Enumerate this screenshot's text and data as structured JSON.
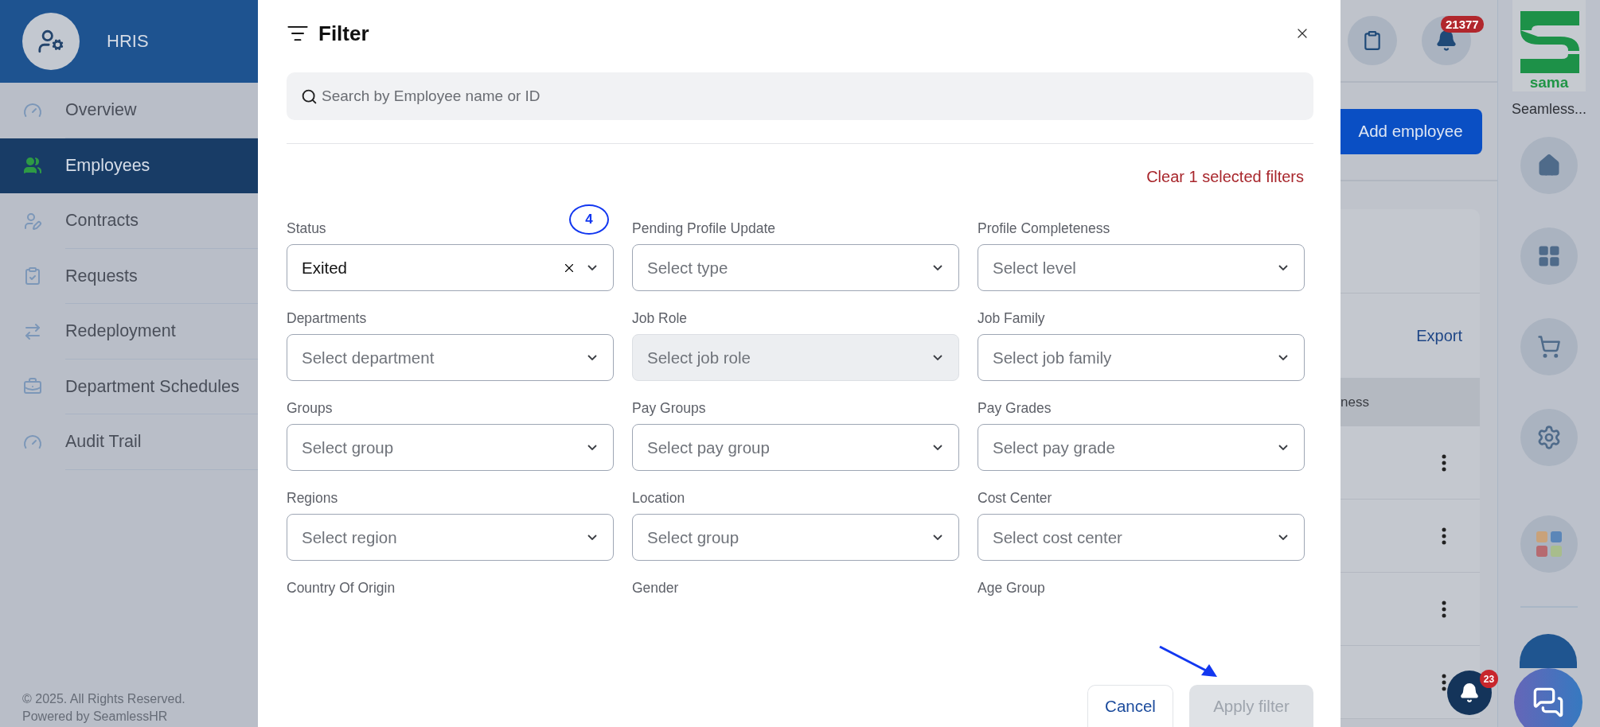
{
  "sidebar": {
    "title": "HRIS",
    "items": [
      {
        "label": "Overview",
        "selected": false
      },
      {
        "label": "Employees",
        "selected": true
      },
      {
        "label": "Contracts",
        "selected": false
      },
      {
        "label": "Requests",
        "selected": false
      },
      {
        "label": "Redeployment",
        "selected": false
      },
      {
        "label": "Department Schedules",
        "selected": false
      },
      {
        "label": "Audit Trail",
        "selected": false
      }
    ],
    "footer": [
      "© 2025. All Rights Reserved.",
      "Powered by SeamlessHR"
    ]
  },
  "filter_dialog": {
    "title": "Filter",
    "search": {
      "placeholder": "Search by Employee name or ID"
    },
    "clear_link": "Clear 1 selected filters",
    "fields": [
      {
        "kind": "select",
        "label": "Status",
        "value": "Exited",
        "disabled": false
      },
      {
        "kind": "select",
        "label": "Pending Profile Update",
        "placeholder": "Select type",
        "disabled": false
      },
      {
        "kind": "select",
        "label": "Profile Completeness",
        "placeholder": "Select level",
        "disabled": false
      },
      {
        "kind": "select",
        "label": "Departments",
        "placeholder": "Select department",
        "disabled": false
      },
      {
        "kind": "select",
        "label": "Job Role",
        "placeholder": "Select job role",
        "disabled": true
      },
      {
        "kind": "select",
        "label": "Job Family",
        "placeholder": "Select job family",
        "disabled": false
      },
      {
        "kind": "select",
        "label": "Groups",
        "placeholder": "Select group",
        "disabled": false
      },
      {
        "kind": "select",
        "label": "Pay Groups",
        "placeholder": "Select pay group",
        "disabled": false
      },
      {
        "kind": "select",
        "label": "Pay Grades",
        "placeholder": "Select pay grade",
        "disabled": false
      },
      {
        "kind": "select",
        "label": "Regions",
        "placeholder": "Select region",
        "disabled": false
      },
      {
        "kind": "select",
        "label": "Location",
        "placeholder": "Select group",
        "disabled": false
      },
      {
        "kind": "select",
        "label": "Cost Center",
        "placeholder": "Select cost center",
        "disabled": false
      },
      {
        "kind": "label",
        "label": "Country Of Origin"
      },
      {
        "kind": "label",
        "label": "Gender"
      },
      {
        "kind": "label",
        "label": "Age Group"
      }
    ],
    "buttons": [
      {
        "kind": "secondary",
        "label": "Cancel",
        "disabled": false
      },
      {
        "kind": "primary",
        "label": "Apply filter",
        "disabled": true
      }
    ]
  },
  "annotations": [
    {
      "kind": "circle",
      "label": "4"
    },
    {
      "kind": "arrow"
    }
  ],
  "background_page": {
    "notification_count": "21377",
    "add_button": "Add employee",
    "export_link": "Export",
    "table_header": "ness"
  },
  "right_rail": {
    "brand": "sama",
    "brand_caption": "Seamless...",
    "chat_notification_count": "23"
  }
}
